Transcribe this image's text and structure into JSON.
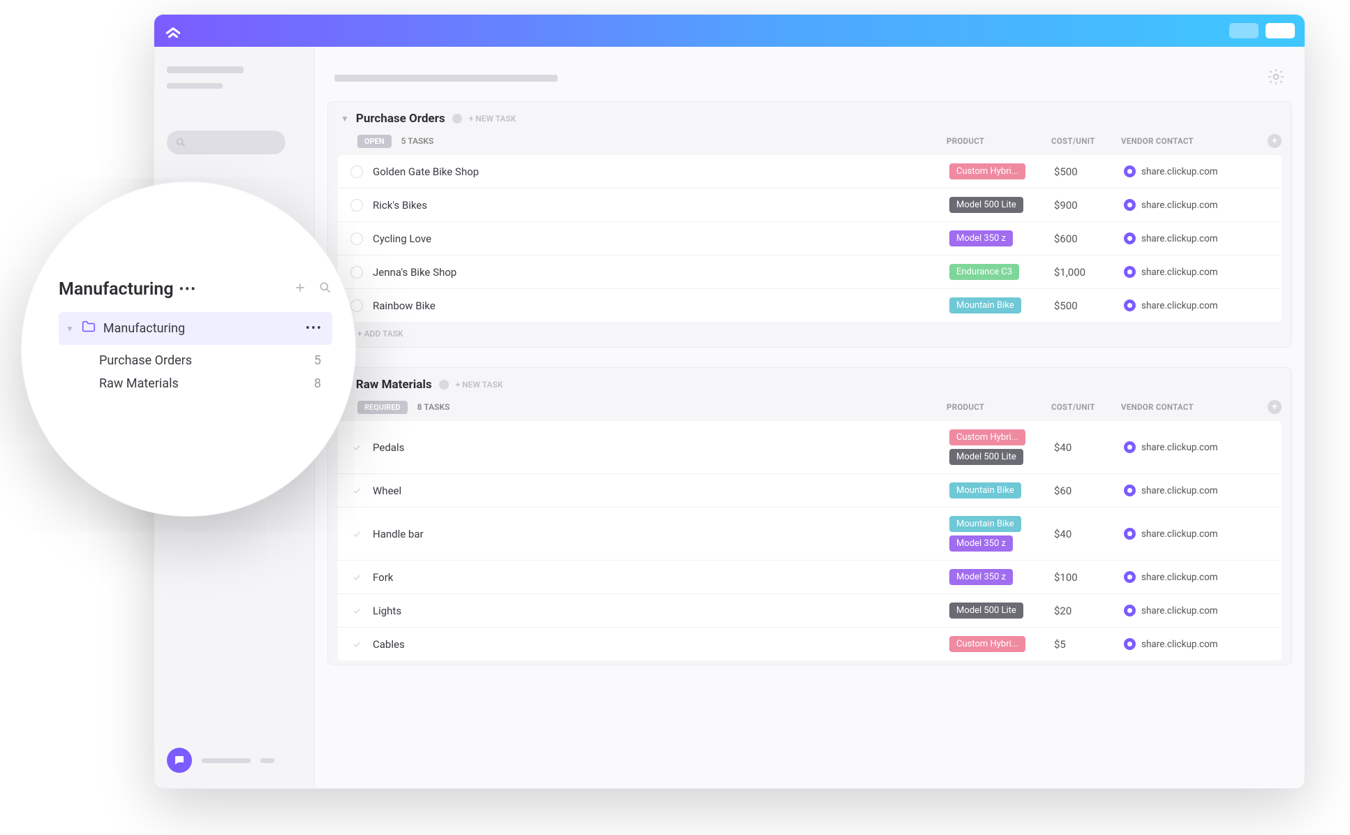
{
  "sidebar": {
    "space_name": "Manufacturing",
    "folder_name": "Manufacturing",
    "lists": [
      {
        "name": "Purchase Orders",
        "count": "5"
      },
      {
        "name": "Raw Materials",
        "count": "8"
      }
    ]
  },
  "columns": {
    "product": "PRODUCT",
    "cost": "COST/UNIT",
    "vendor": "VENDOR CONTACT"
  },
  "groups": [
    {
      "title": "Purchase Orders",
      "new_task": "+ NEW TASK",
      "status_label": "OPEN",
      "count_label": "5 TASKS",
      "add_task": "+ ADD TASK",
      "rows": [
        {
          "name": "Golden Gate Bike Shop",
          "tags": [
            {
              "label": "Custom Hybri...",
              "cls": "tag-hybrid"
            }
          ],
          "cost": "$500",
          "vendor": "share.clickup.com"
        },
        {
          "name": "Rick's Bikes",
          "tags": [
            {
              "label": "Model 500 Lite",
              "cls": "tag-500"
            }
          ],
          "cost": "$900",
          "vendor": "share.clickup.com"
        },
        {
          "name": "Cycling Love",
          "tags": [
            {
              "label": "Model 350 z",
              "cls": "tag-350"
            }
          ],
          "cost": "$600",
          "vendor": "share.clickup.com"
        },
        {
          "name": "Jenna's Bike Shop",
          "tags": [
            {
              "label": "Endurance C3",
              "cls": "tag-endurance"
            }
          ],
          "cost": "$1,000",
          "vendor": "share.clickup.com"
        },
        {
          "name": "Rainbow Bike",
          "tags": [
            {
              "label": "Mountain Bike",
              "cls": "tag-mountain"
            }
          ],
          "cost": "$500",
          "vendor": "share.clickup.com"
        }
      ]
    },
    {
      "title": "Raw Materials",
      "new_task": "+ NEW TASK",
      "status_label": "REQUIRED",
      "count_label": "8 TASKS",
      "add_task": "",
      "rows": [
        {
          "name": "Pedals",
          "tags": [
            {
              "label": "Custom Hybri...",
              "cls": "tag-hybrid"
            },
            {
              "label": "Model 500 Lite",
              "cls": "tag-500"
            }
          ],
          "cost": "$40",
          "vendor": "share.clickup.com"
        },
        {
          "name": "Wheel",
          "tags": [
            {
              "label": "Mountain Bike",
              "cls": "tag-mountain"
            }
          ],
          "cost": "$60",
          "vendor": "share.clickup.com"
        },
        {
          "name": "Handle bar",
          "tags": [
            {
              "label": "Mountain Bike",
              "cls": "tag-mountain"
            },
            {
              "label": "Model 350 z",
              "cls": "tag-350"
            }
          ],
          "cost": "$40",
          "vendor": "share.clickup.com"
        },
        {
          "name": "Fork",
          "tags": [
            {
              "label": "Model 350 z",
              "cls": "tag-350"
            }
          ],
          "cost": "$100",
          "vendor": "share.clickup.com"
        },
        {
          "name": "Lights",
          "tags": [
            {
              "label": "Model 500 Lite",
              "cls": "tag-500"
            }
          ],
          "cost": "$20",
          "vendor": "share.clickup.com"
        },
        {
          "name": "Cables",
          "tags": [
            {
              "label": "Custom Hybri...",
              "cls": "tag-hybrid"
            }
          ],
          "cost": "$5",
          "vendor": "share.clickup.com"
        }
      ]
    }
  ]
}
